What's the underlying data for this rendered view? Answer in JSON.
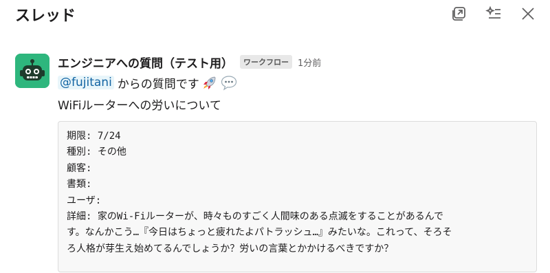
{
  "header": {
    "title": "スレッド",
    "icons": [
      "thread-window-icon",
      "sparkle-list-icon",
      "close-icon"
    ]
  },
  "message": {
    "sender": "エンジニアへの質問（テスト用）",
    "badge": "ワークフロー",
    "time": "1分前",
    "mention": "@fujitani",
    "line2_text": "からの質問です",
    "emojis": [
      "rocket-emoji",
      "speech-balloon-emoji"
    ],
    "line3": "WiFiルーターへの労いについて",
    "fields": [
      {
        "key": "期限:",
        "value": "7/24"
      },
      {
        "key": "種別:",
        "value": "その他"
      },
      {
        "key": "顧客:",
        "value": ""
      },
      {
        "key": "書類:",
        "value": ""
      },
      {
        "key": "ユーザ:",
        "value": ""
      }
    ],
    "detail": {
      "key": "詳細:",
      "lines": [
        "家のWi-Fiルーターが、時々ものすごく人間味のある点滅をすることがあるんで",
        "す。なんかこう…『今日はちょっと疲れたよパトラッシュ…』みたいな。これって、そろそ",
        "ろ人格が芽生え始めてるんでしょうか？労いの言葉とかかけるべきですか？"
      ]
    }
  },
  "colors": {
    "avatar_bg": "#2eb67d",
    "mention_bg": "#e8f5fa",
    "mention_text": "#1264a3"
  }
}
